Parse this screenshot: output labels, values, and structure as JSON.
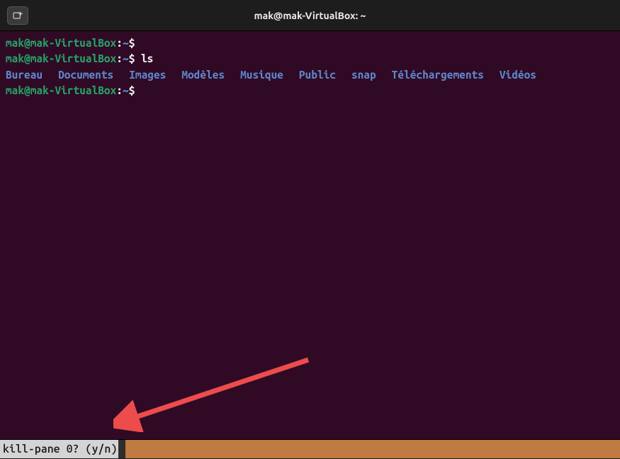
{
  "titlebar": {
    "title": "mak@mak-VirtualBox: ~"
  },
  "prompt": {
    "user": "mak@mak-VirtualBox",
    "sep": ":",
    "path": "~",
    "symbol": "$"
  },
  "commands": {
    "line1_cmd": "",
    "line2_cmd": " ls",
    "line3_cmd": ""
  },
  "ls_output": {
    "items": [
      "Bureau",
      "Documents",
      "Images",
      "Modèles",
      "Musique",
      "Public",
      "snap",
      "Téléchargements",
      "Vidéos"
    ]
  },
  "status": {
    "prompt": "kill-pane 0? (y/n)"
  }
}
